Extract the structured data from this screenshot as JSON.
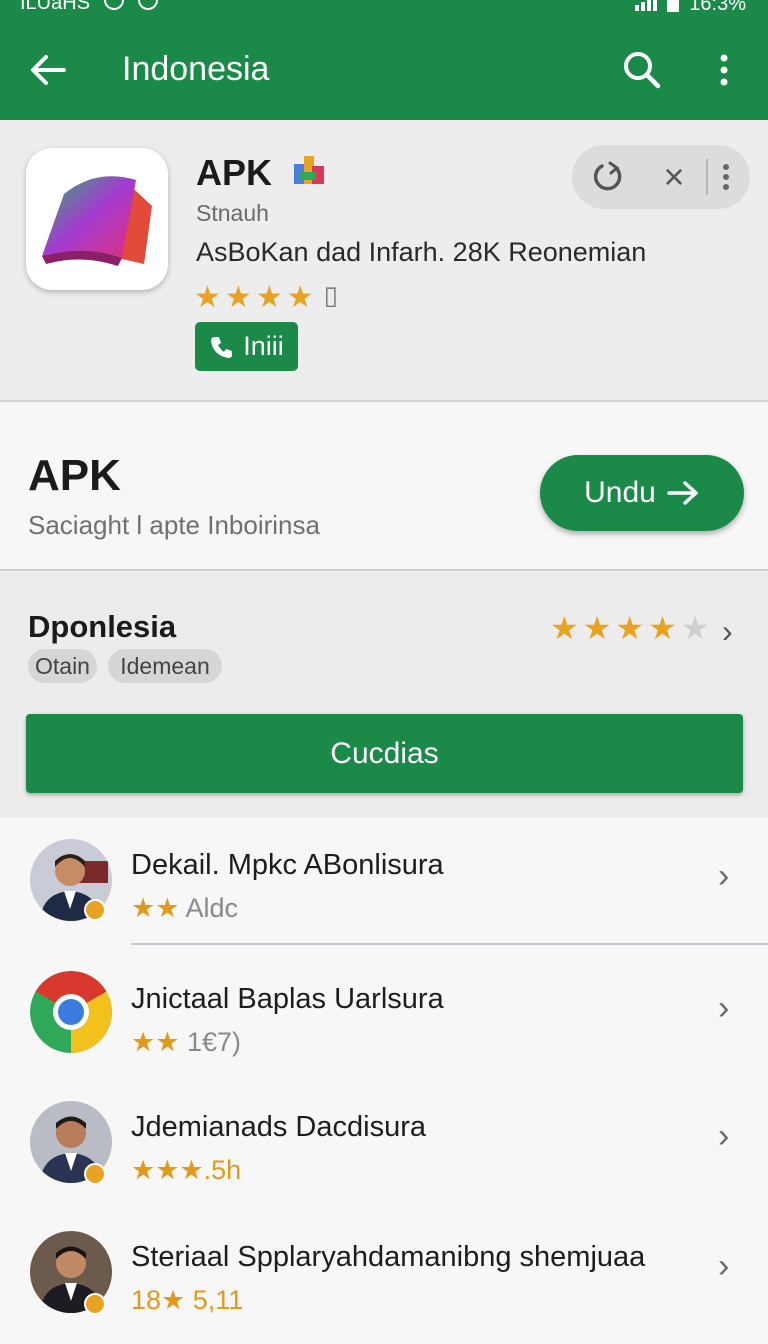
{
  "status_bar": {
    "left_text": "ILUaHS",
    "right_text": "16:3%"
  },
  "app_bar": {
    "title": "Indonesia",
    "back_icon": "arrow-left-icon",
    "search_icon": "search-icon",
    "more_icon": "more-vert-icon"
  },
  "app": {
    "name": "APK",
    "developer": "Stnauh",
    "description": "AsBoKan dad Infarh. 28K Reonemian",
    "rating_stars": 4,
    "install_label": "Iniii",
    "controls": {
      "refresh": "refresh-icon",
      "close": "×",
      "more": "more-vert-icon"
    }
  },
  "download": {
    "title": "APK",
    "subtitle": "Saciaght l apte Inboirinsa",
    "button_label": "Undu",
    "button_arrow": "→"
  },
  "rating_section": {
    "title": "Dponlesia",
    "tags": [
      "Otain",
      "Idemean"
    ],
    "stars": 4,
    "max_stars": 5,
    "chevron": "›",
    "cta_label": "Cucdias"
  },
  "list": [
    {
      "title": "Dekail. Mpkc ABonlisura",
      "stars": "★★",
      "meta": "Aldc",
      "avatar": "person"
    },
    {
      "title": "Jnictaal Baplas Uarlsura",
      "stars": "★★",
      "meta": "1€7)",
      "avatar": "chrome"
    },
    {
      "title": "Jdemianads Dacdisura",
      "stars": "★★★",
      "meta": ".5h",
      "avatar": "person"
    },
    {
      "title": "Steriaal Spplaryahdamanibng shemjuaa",
      "stars": "18★",
      "meta": "5,11",
      "avatar": "person"
    }
  ],
  "colors": {
    "brand_green": "#1b8a48",
    "star": "#e8a322"
  }
}
